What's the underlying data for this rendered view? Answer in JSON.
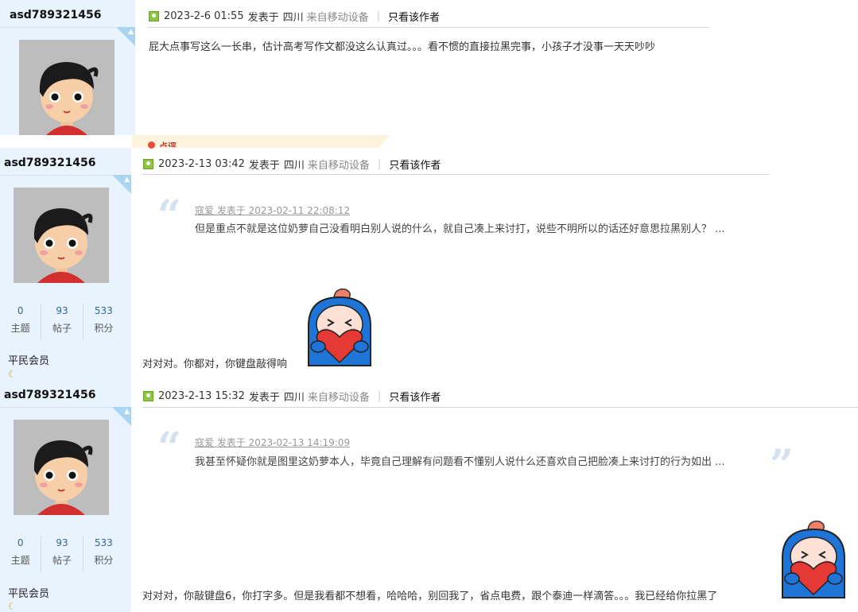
{
  "posts": [
    {
      "username": "asd789321456",
      "meta": {
        "date": "2023-2-6 01:55",
        "posted_in": "发表于",
        "location": "四川",
        "device": "来自移动设备",
        "author_only": "只看该作者"
      },
      "content": "屁大点事写这么一长串，估计高考写作文都没这么认真过。。。看不惯的直接拉黑完事，小孩子才没事一天天吵吵",
      "rate_label": "点评"
    },
    {
      "username": "asd789321456",
      "meta": {
        "date": "2023-2-13 03:42",
        "posted_in": "发表于",
        "location": "四川",
        "device": "来自移动设备",
        "author_only": "只看该作者"
      },
      "quote": {
        "author": "寇爱 发表于 2023-02-11 22:08:12",
        "text": "但是重点不就是这位奶萝自己没看明白别人说的什么，就自己凑上来讨打，说些不明所以的话还好意思拉黑别人？ ..."
      },
      "content": "对对对。你都对，你键盘敲得响",
      "stats": [
        {
          "num": "0",
          "label": "主题"
        },
        {
          "num": "93",
          "label": "帖子"
        },
        {
          "num": "533",
          "label": "积分"
        }
      ],
      "rank": "平民会员"
    },
    {
      "username": "asd789321456",
      "meta": {
        "date": "2023-2-13 15:32",
        "posted_in": "发表于",
        "location": "四川",
        "device": "来自移动设备",
        "author_only": "只看该作者"
      },
      "quote": {
        "author": "寇爱 发表于 2023-02-13 14:19:09",
        "text": "我甚至怀疑你就是图里这奶萝本人，毕竟自己理解有问题看不懂别人说什么还喜欢自己把脸凑上来讨打的行为如出 ..."
      },
      "content": "对对对，你敲键盘6，你打字多。但是我看都不想看，哈哈哈，别回我了，省点电费，跟个泰迪一样滴答。。。我已经给你拉黑了",
      "stats": [
        {
          "num": "0",
          "label": "主题"
        },
        {
          "num": "93",
          "label": "帖子"
        },
        {
          "num": "533",
          "label": "积分"
        }
      ],
      "rank": "平民会员"
    }
  ],
  "icons": {
    "android": "android-icon",
    "post": "post-picture-icon",
    "moon": "moon-icon",
    "sticker": "heart-hug-sticker"
  },
  "colors": {
    "sidebar_bg": "#e9f3fd",
    "stat_num": "#336699",
    "corner": "#a9d5f2"
  }
}
